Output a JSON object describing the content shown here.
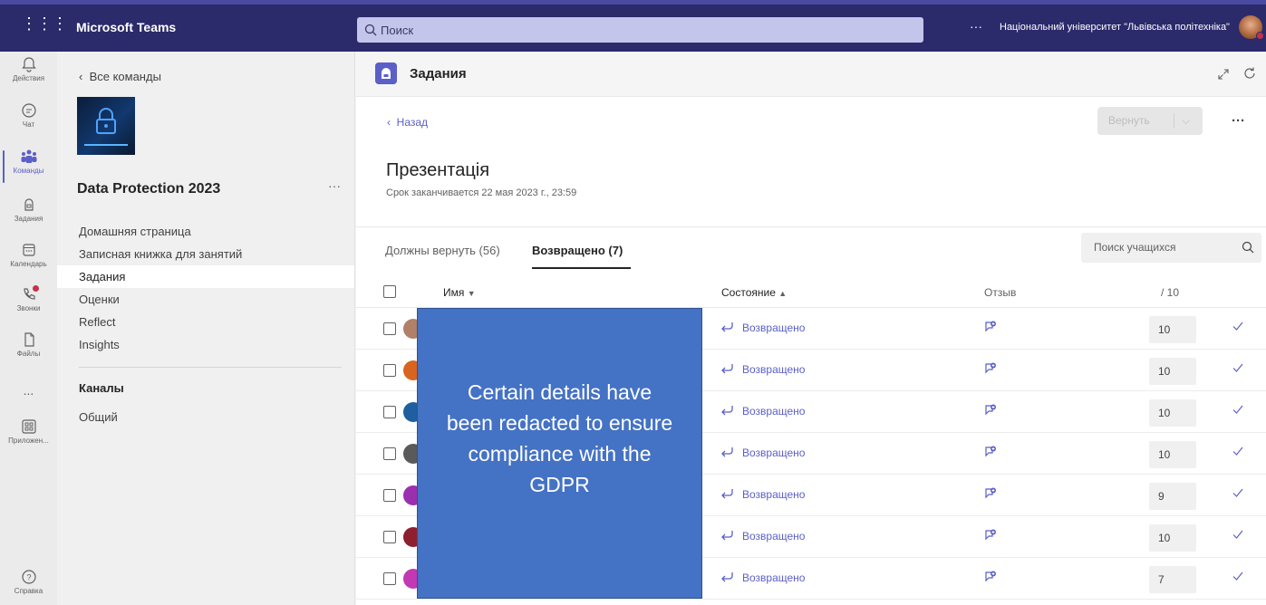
{
  "app": {
    "name": "Microsoft Teams",
    "org": "Національний університет \"Львівська політехніка\""
  },
  "search": {
    "placeholder": "Поиск"
  },
  "rail": [
    {
      "label": "Действия",
      "icon": "bell-icon"
    },
    {
      "label": "Чат",
      "icon": "chat-icon"
    },
    {
      "label": "Команды",
      "icon": "teams-icon"
    },
    {
      "label": "Задания",
      "icon": "assignments-icon"
    },
    {
      "label": "Календарь",
      "icon": "calendar-icon"
    },
    {
      "label": "Звонки",
      "icon": "calls-icon"
    },
    {
      "label": "Файлы",
      "icon": "files-icon"
    },
    {
      "label": "...",
      "icon": "more-icon"
    },
    {
      "label": "Приложен...",
      "icon": "apps-icon"
    },
    {
      "label": "Справка",
      "icon": "help-icon"
    }
  ],
  "sidebar": {
    "back_label": "Все команды",
    "team_name": "Data Protection 2023",
    "more": "···",
    "items": [
      {
        "label": "Домашняя страница"
      },
      {
        "label": "Записная книжка для занятий"
      },
      {
        "label": "Задания"
      },
      {
        "label": "Оценки"
      },
      {
        "label": "Reflect"
      },
      {
        "label": "Insights"
      }
    ],
    "channels_header": "Каналы",
    "channel_general": "Общий"
  },
  "header": {
    "title": "Задания"
  },
  "page": {
    "back_label": "Назад",
    "return_label": "Вернуть",
    "more": "···",
    "assignment_title": "Презентація",
    "due": "Срок заканчивается 22 мая 2023 г., 23:59"
  },
  "tabs": [
    {
      "label": "Должны вернуть (56)"
    },
    {
      "label": "Возвращено (7)"
    }
  ],
  "student_search": {
    "placeholder": "Поиск учащихся"
  },
  "table": {
    "headers": {
      "name": "Имя",
      "status": "Состояние",
      "feedback": "Отзыв",
      "points": "/ 10"
    },
    "rows": [
      {
        "status": "Возвращено",
        "grade": "10",
        "avatar_color": "#b08068"
      },
      {
        "status": "Возвращено",
        "grade": "10",
        "avatar_color": "#d9641f"
      },
      {
        "status": "Возвращено",
        "grade": "10",
        "avatar_color": "#1f5f9f"
      },
      {
        "status": "Возвращено",
        "grade": "10",
        "avatar_color": "#5a5a5a"
      },
      {
        "status": "Возвращено",
        "grade": "9",
        "avatar_color": "#9b2fae"
      },
      {
        "status": "Возвращено",
        "grade": "10",
        "avatar_color": "#8e1f2f"
      },
      {
        "status": "Возвращено",
        "grade": "7",
        "avatar_color": "#c239b3"
      }
    ]
  },
  "redaction_note": "Certain details have been redacted to ensure compliance with the GDPR",
  "colors": {
    "brand": "#5b5fc7",
    "topbar": "#2b2a6b",
    "redaction": "#4472c4"
  }
}
